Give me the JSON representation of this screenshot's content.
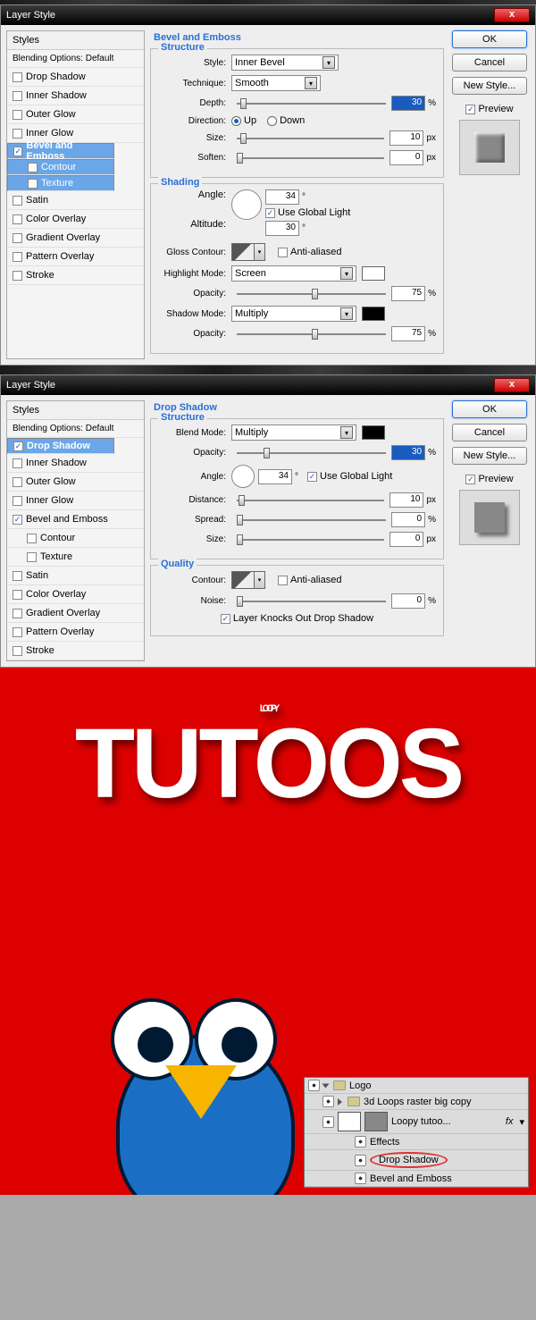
{
  "dialog_title": "Layer Style",
  "styles": {
    "header": "Styles",
    "blending": "Blending Options: Default",
    "items": [
      "Drop Shadow",
      "Inner Shadow",
      "Outer Glow",
      "Inner Glow",
      "Bevel and Emboss",
      "Contour",
      "Texture",
      "Satin",
      "Color Overlay",
      "Gradient Overlay",
      "Pattern Overlay",
      "Stroke"
    ]
  },
  "bevel": {
    "title": "Bevel and Emboss",
    "structure": "Structure",
    "style_label": "Style:",
    "style_value": "Inner Bevel",
    "tech_label": "Technique:",
    "tech_value": "Smooth",
    "depth_label": "Depth:",
    "depth_value": "30",
    "depth_unit": "%",
    "dir_label": "Direction:",
    "up": "Up",
    "down": "Down",
    "size_label": "Size:",
    "size_value": "10",
    "size_unit": "px",
    "soften_label": "Soften:",
    "soften_value": "0",
    "soften_unit": "px",
    "shading": "Shading",
    "angle_label": "Angle:",
    "angle_value": "34",
    "deg": "°",
    "global": "Use Global Light",
    "alt_label": "Altitude:",
    "alt_value": "30",
    "gloss_label": "Gloss Contour:",
    "anti": "Anti-aliased",
    "hmode_label": "Highlight Mode:",
    "hmode_value": "Screen",
    "opac_label": "Opacity:",
    "hopac": "75",
    "hopac_unit": "%",
    "smode_label": "Shadow Mode:",
    "smode_value": "Multiply",
    "sopac": "75",
    "sopac_unit": "%"
  },
  "shadow": {
    "title": "Drop Shadow",
    "structure": "Structure",
    "bmode_label": "Blend Mode:",
    "bmode_value": "Multiply",
    "opac_label": "Opacity:",
    "opac_value": "30",
    "opac_unit": "%",
    "angle_label": "Angle:",
    "angle_value": "34",
    "deg": "°",
    "global": "Use Global Light",
    "dist_label": "Distance:",
    "dist_value": "10",
    "dist_unit": "px",
    "spread_label": "Spread:",
    "spread_value": "0",
    "spread_unit": "%",
    "size_label": "Size:",
    "size_value": "0",
    "size_unit": "px",
    "quality": "Quality",
    "contour_label": "Contour:",
    "anti": "Anti-aliased",
    "noise_label": "Noise:",
    "noise_value": "0",
    "noise_unit": "%",
    "knock": "Layer Knocks Out Drop Shadow"
  },
  "buttons": {
    "ok": "OK",
    "cancel": "Cancel",
    "newstyle": "New Style...",
    "preview": "Preview"
  },
  "layers": {
    "group": "Logo",
    "sub": "3d Loops  raster  big copy",
    "layer": "Loopy tutoo...",
    "fx": "fx",
    "effects": "Effects",
    "ds": "Drop Shadow",
    "be": "Bevel and Emboss"
  },
  "logo": {
    "w1": "LOOPY",
    "w2": "TUTOOS"
  }
}
